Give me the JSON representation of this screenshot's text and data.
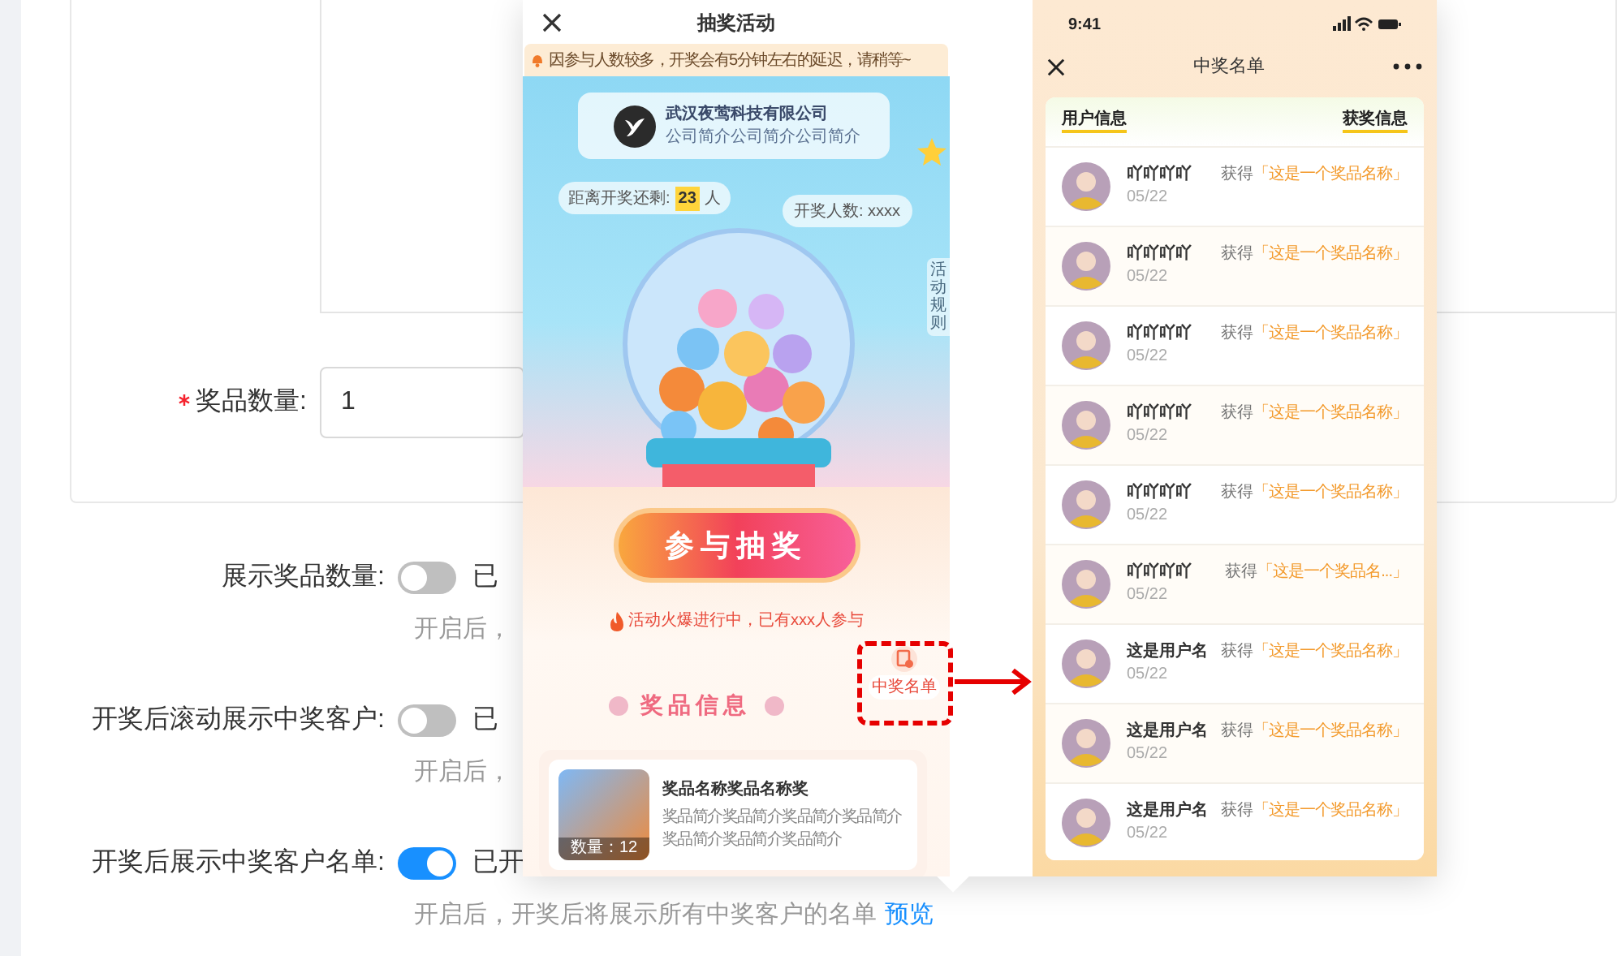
{
  "form": {
    "quantity": {
      "label": "奖品数量:",
      "required": true,
      "value": "1"
    },
    "switches": [
      {
        "label": "展示奖品数量:",
        "on": false,
        "state_text": "已",
        "hint": "开启后，"
      },
      {
        "label": "开奖后滚动展示中奖客户:",
        "on": false,
        "state_text": "已",
        "hint": "开启后，"
      },
      {
        "label": "开奖后展示中奖客户名单:",
        "on": true,
        "state_text": "已开",
        "hint": "开启后，开奖后将展示所有中奖客户的名单",
        "link": "预览"
      }
    ]
  },
  "lottery_preview": {
    "title": "抽奖活动",
    "notice": "因参与人数较多，开奖会有5分钟左右的延迟，请稍等~",
    "company": {
      "name": "武汉夜莺科技有限公司",
      "intro": "公司简介公司简介公司简介"
    },
    "remaining": {
      "label": "距离开奖还剩:",
      "count": "23",
      "unit": "人"
    },
    "draw_count": "开奖人数: xxxx",
    "rules": "活动规则",
    "join_button": "参与抽奖",
    "hot_text": "活动火爆进行中，已有xxx人参与",
    "winners_entry": "中奖名单",
    "prize_heading": "奖品信息",
    "prize": {
      "name": "奖品名称奖品名称奖",
      "description": "奖品简介奖品简介奖品简介奖品简介奖品简介奖品简介奖品简介",
      "quantity": "数量：12"
    }
  },
  "winners_preview": {
    "time": "9:41",
    "title": "中奖名单",
    "col_user": "用户信息",
    "col_prize": "获奖信息",
    "rows": [
      {
        "name": "吖吖吖吖",
        "date": "05/22",
        "won": "获得",
        "prize": "「这是一个奖品名称」"
      },
      {
        "name": "吖吖吖吖",
        "date": "05/22",
        "won": "获得",
        "prize": "「这是一个奖品名称」"
      },
      {
        "name": "吖吖吖吖",
        "date": "05/22",
        "won": "获得",
        "prize": "「这是一个奖品名称」"
      },
      {
        "name": "吖吖吖吖",
        "date": "05/22",
        "won": "获得",
        "prize": "「这是一个奖品名称」"
      },
      {
        "name": "吖吖吖吖",
        "date": "05/22",
        "won": "获得",
        "prize": "「这是一个奖品名称」"
      },
      {
        "name": "吖吖吖吖",
        "date": "05/22",
        "won": "获得",
        "prize": "「这是一个奖品名...」"
      },
      {
        "name": "这是用户名",
        "date": "05/22",
        "won": "获得",
        "prize": "「这是一个奖品名称」"
      },
      {
        "name": "这是用户名",
        "date": "05/22",
        "won": "获得",
        "prize": "「这是一个奖品名称」"
      },
      {
        "name": "这是用户名",
        "date": "05/22",
        "won": "获得",
        "prize": "「这是一个奖品名称」"
      }
    ]
  }
}
